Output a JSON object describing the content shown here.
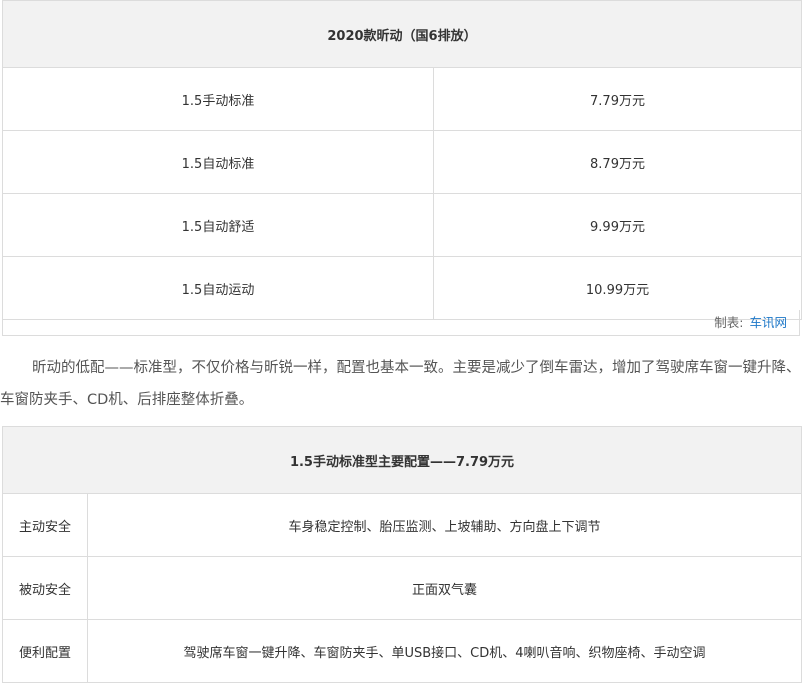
{
  "price_table": {
    "title": "2020款昕动（国6排放）",
    "rows": [
      {
        "model": "1.5手动标准",
        "price": "7.79万元"
      },
      {
        "model": "1.5自动标准",
        "price": "8.79万元"
      },
      {
        "model": "1.5自动舒适",
        "price": "9.99万元"
      },
      {
        "model": "1.5自动运动",
        "price": "10.99万元"
      }
    ],
    "source_label": "制表:",
    "source_name": "车讯网"
  },
  "paragraph": "昕动的低配——标准型，不仅价格与昕锐一样，配置也基本一致。主要是减少了倒车雷达，增加了驾驶席车窗一键升降、车窗防夹手、CD机、后排座整体折叠。",
  "spec_table": {
    "title": "1.5手动标准型主要配置——7.79万元",
    "rows": [
      {
        "category": "主动安全",
        "items": "车身稳定控制、胎压监测、上坡辅助、方向盘上下调节"
      },
      {
        "category": "被动安全",
        "items": "正面双气囊"
      },
      {
        "category": "便利配置",
        "items": "驾驶席车窗一键升降、车窗防夹手、单USB接口、CD机、4喇叭音响、织物座椅、手动空调"
      }
    ]
  }
}
